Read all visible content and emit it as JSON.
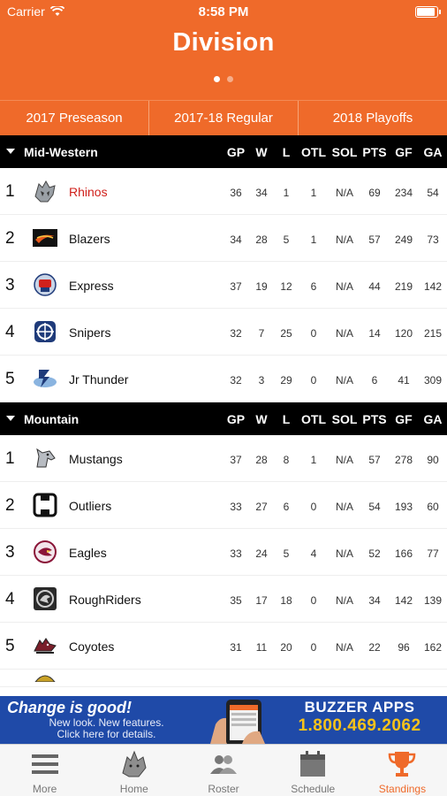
{
  "status_bar": {
    "carrier": "Carrier",
    "time": "8:58 PM"
  },
  "header": {
    "title": "Division",
    "page_dots": 2,
    "active_dot": 0
  },
  "tabs": [
    {
      "label": "2017 Preseason"
    },
    {
      "label": "2017-18 Regular"
    },
    {
      "label": "2018 Playoffs"
    }
  ],
  "columns": [
    "GP",
    "W",
    "L",
    "OTL",
    "SOL",
    "PTS",
    "GF",
    "GA"
  ],
  "divisions": [
    {
      "name": "Mid-Western",
      "teams": [
        {
          "rank": "1",
          "name": "Rhinos",
          "highlight": true,
          "logo": "rhino-logo",
          "stats": [
            "36",
            "34",
            "1",
            "1",
            "N/A",
            "69",
            "234",
            "54"
          ]
        },
        {
          "rank": "2",
          "name": "Blazers",
          "logo": "blazers-logo",
          "stats": [
            "34",
            "28",
            "5",
            "1",
            "N/A",
            "57",
            "249",
            "73"
          ]
        },
        {
          "rank": "3",
          "name": "Express",
          "logo": "express-logo",
          "stats": [
            "37",
            "19",
            "12",
            "6",
            "N/A",
            "44",
            "219",
            "142"
          ]
        },
        {
          "rank": "4",
          "name": "Snipers",
          "logo": "snipers-logo",
          "stats": [
            "32",
            "7",
            "25",
            "0",
            "N/A",
            "14",
            "120",
            "215"
          ]
        },
        {
          "rank": "5",
          "name": "Jr Thunder",
          "logo": "jr-thunder-logo",
          "stats": [
            "32",
            "3",
            "29",
            "0",
            "N/A",
            "6",
            "41",
            "309"
          ]
        }
      ]
    },
    {
      "name": "Mountain",
      "teams": [
        {
          "rank": "1",
          "name": "Mustangs",
          "logo": "mustangs-logo",
          "stats": [
            "37",
            "28",
            "8",
            "1",
            "N/A",
            "57",
            "278",
            "90"
          ]
        },
        {
          "rank": "2",
          "name": "Outliers",
          "logo": "outliers-logo",
          "stats": [
            "33",
            "27",
            "6",
            "0",
            "N/A",
            "54",
            "193",
            "60"
          ]
        },
        {
          "rank": "3",
          "name": "Eagles",
          "logo": "eagles-logo",
          "stats": [
            "33",
            "24",
            "5",
            "4",
            "N/A",
            "52",
            "166",
            "77"
          ]
        },
        {
          "rank": "4",
          "name": "RoughRiders",
          "logo": "roughriders-logo",
          "stats": [
            "35",
            "17",
            "18",
            "0",
            "N/A",
            "34",
            "142",
            "139"
          ]
        },
        {
          "rank": "5",
          "name": "Coyotes",
          "logo": "coyotes-logo",
          "stats": [
            "31",
            "11",
            "20",
            "0",
            "N/A",
            "22",
            "96",
            "162"
          ]
        }
      ]
    }
  ],
  "ad": {
    "headline": "Change is good!",
    "subline1": "New look. New features.",
    "subline2": "Click here for details.",
    "brand": "BUZZER APPS",
    "phone": "1.800.469.2062"
  },
  "tabbar": [
    {
      "label": "More",
      "icon": "menu-icon",
      "active": false
    },
    {
      "label": "Home",
      "icon": "rhino-head-icon",
      "active": false
    },
    {
      "label": "Roster",
      "icon": "people-icon",
      "active": false
    },
    {
      "label": "Schedule",
      "icon": "calendar-icon",
      "active": false
    },
    {
      "label": "Standings",
      "icon": "trophy-icon",
      "active": true
    }
  ],
  "colors": {
    "brand_orange": "#ef6a2a",
    "highlight_red": "#d0211c",
    "header_black": "#000000",
    "ad_blue": "#1f4aa8",
    "ad_yellow": "#f7c21a"
  }
}
